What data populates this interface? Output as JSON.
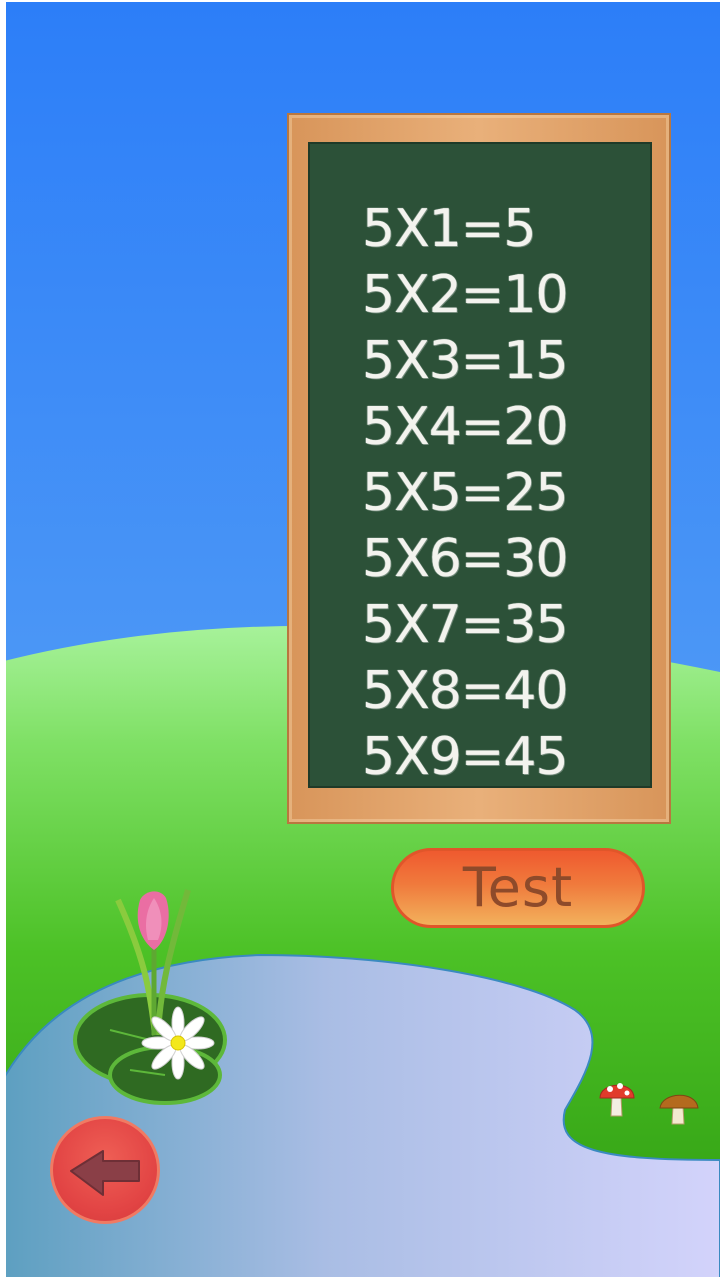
{
  "board": {
    "equations": [
      "5X1=5",
      "5X2=10",
      "5X3=15",
      "5X4=20",
      "5X5=25",
      "5X6=30",
      "5X7=35",
      "5X8=40",
      "5X9=45"
    ]
  },
  "buttons": {
    "test_label": "Test",
    "back_icon": "back-arrow-icon"
  },
  "colors": {
    "sky_top": "#2f80f7",
    "grass": "#4bbf1e",
    "chalkboard": "#2c5138",
    "frame": "#e2a56d",
    "test_button": "#ef5a2f",
    "back_button": "#e24444"
  }
}
